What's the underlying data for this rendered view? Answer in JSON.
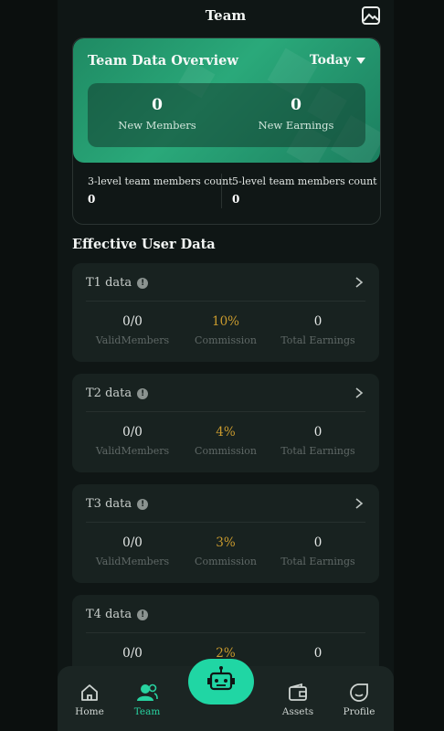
{
  "header": {
    "title": "Team",
    "action_icon": "image-icon"
  },
  "overview": {
    "title": "Team Data Overview",
    "period": "Today",
    "new_members": {
      "value": "0",
      "label": "New Members"
    },
    "new_earnings": {
      "value": "0",
      "label": "New Earnings"
    },
    "level3": {
      "label": "3-level team members count",
      "value": "0"
    },
    "level5": {
      "label": "5-level team members count",
      "value": "0"
    }
  },
  "effective": {
    "title": "Effective User Data",
    "cards": [
      {
        "title": "T1 data",
        "valid": "0/0",
        "valid_label": "ValidMembers",
        "commission": "10%",
        "commission_label": "Commission",
        "earnings": "0",
        "earnings_label": "Total Earnings"
      },
      {
        "title": "T2 data",
        "valid": "0/0",
        "valid_label": "ValidMembers",
        "commission": "4%",
        "commission_label": "Commission",
        "earnings": "0",
        "earnings_label": "Total Earnings"
      },
      {
        "title": "T3 data",
        "valid": "0/0",
        "valid_label": "ValidMembers",
        "commission": "3%",
        "commission_label": "Commission",
        "earnings": "0",
        "earnings_label": "Total Earnings"
      },
      {
        "title": "T4 data",
        "valid": "0/0",
        "valid_label": "",
        "commission": "2%",
        "commission_label": "",
        "earnings": "0",
        "earnings_label": ""
      }
    ]
  },
  "nav": {
    "home": "Home",
    "team": "Team",
    "center_icon": "robot-icon",
    "assets": "Assets",
    "profile": "Profile"
  },
  "colors": {
    "accent": "#20d6a4",
    "commission": "#c99a2e",
    "background": "#0f1615",
    "card": "#182220"
  }
}
